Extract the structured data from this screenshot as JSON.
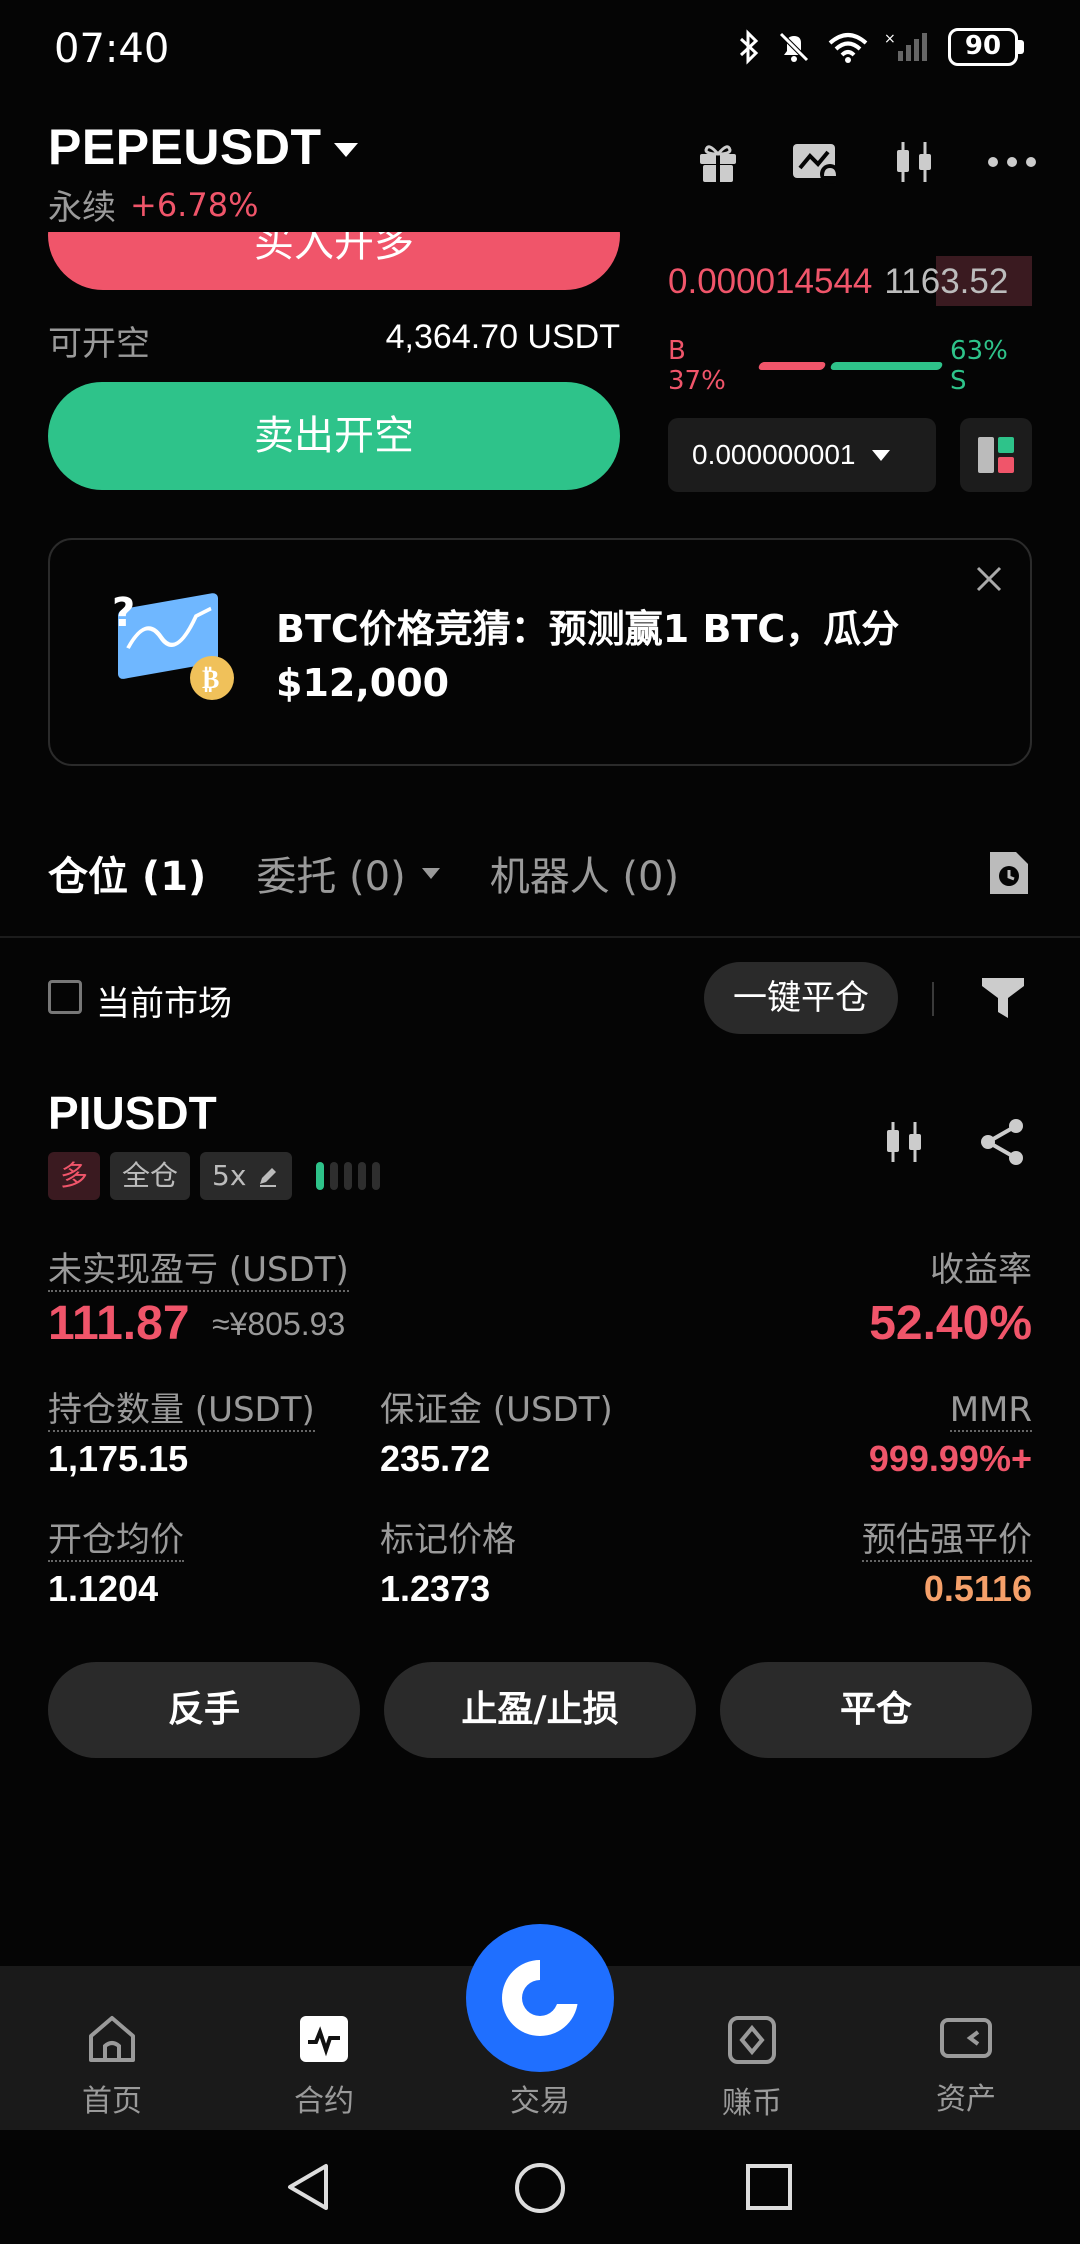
{
  "status_bar": {
    "time": "07:40",
    "battery": "90"
  },
  "header": {
    "pair": "PEPEUSDT",
    "contract_type": "永续",
    "change": "+6.78%"
  },
  "trade_panel": {
    "buy_label": "买入开多",
    "available_label": "可开空",
    "available_value": "4,364.70 USDT",
    "sell_label": "卖出开空"
  },
  "orderbook": {
    "ask_price": "0.000014544",
    "ask_qty": "1163.52",
    "buy_ratio": "B 37%",
    "sell_ratio": "63% S",
    "buy_fraction": 0.37,
    "precision": "0.000000001"
  },
  "promo": {
    "text": "BTC价格竞猜：预测赢1 BTC，瓜分 $12,000"
  },
  "tabs": [
    {
      "label": "仓位 (1)",
      "active": true
    },
    {
      "label": "委托 (0)",
      "active": false
    },
    {
      "label": "机器人 (0)",
      "active": false
    }
  ],
  "filter": {
    "current_market_label": "当前市场",
    "close_all_label": "一键平仓"
  },
  "position": {
    "symbol": "PIUSDT",
    "side": "多",
    "margin_mode": "全仓",
    "leverage": "5x",
    "strength_level": 1,
    "strength_max": 5,
    "unrealized_pnl_label": "未实现盈亏 (USDT)",
    "unrealized_pnl": "111.87",
    "unrealized_pnl_cny": "≈¥805.93",
    "roe_label": "收益率",
    "roe": "52.40%",
    "size_label": "持仓数量 (USDT)",
    "size": "1,175.15",
    "margin_label": "保证金 (USDT)",
    "margin": "235.72",
    "mmr_label": "MMR",
    "mmr": "999.99%+",
    "entry_label": "开仓均价",
    "entry": "1.1204",
    "mark_label": "标记价格",
    "mark": "1.2373",
    "liq_label": "预估强平价",
    "liq": "0.5116"
  },
  "actions": {
    "reverse": "反手",
    "tpsl": "止盈/止损",
    "close": "平仓"
  },
  "bottom_nav": [
    {
      "label": "首页",
      "icon": "home-icon"
    },
    {
      "label": "合约",
      "icon": "futures-icon"
    },
    {
      "label": "交易",
      "icon": "trade-icon"
    },
    {
      "label": "赚币",
      "icon": "earn-icon"
    },
    {
      "label": "资产",
      "icon": "assets-icon"
    }
  ],
  "colors": {
    "red": "#f0556a",
    "green": "#2ec38a",
    "orange": "#f5a06a",
    "blue": "#1f6fff"
  }
}
